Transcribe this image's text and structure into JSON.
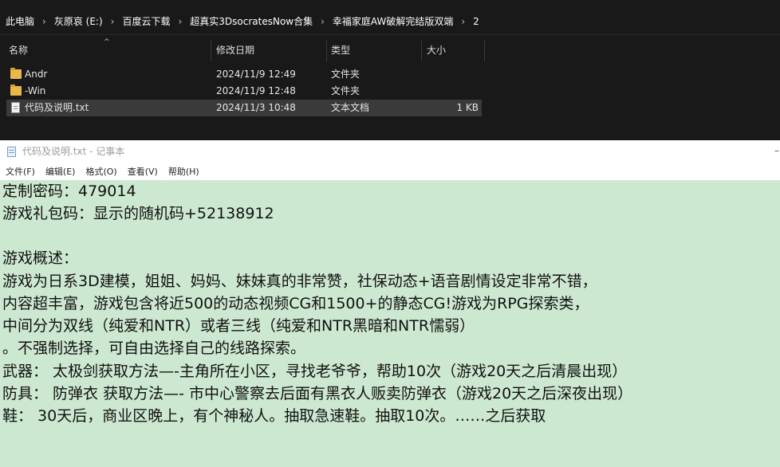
{
  "explorer": {
    "breadcrumb": [
      "此电脑",
      "灰原哀 (E:)",
      "百度云下载",
      "超真实3DsocratesNow合集",
      "幸福家庭AW破解完结版双端",
      "2"
    ],
    "separator": "›",
    "columns": {
      "name": "名称",
      "modified": "修改日期",
      "type": "类型",
      "size": "大小"
    },
    "files": [
      {
        "icon": "folder-icon",
        "name": "Andr",
        "modified": "2024/11/9 12:49",
        "type": "文件夹",
        "size": ""
      },
      {
        "icon": "folder-icon",
        "name": "-Win",
        "modified": "2024/11/9 12:48",
        "type": "文件夹",
        "size": ""
      },
      {
        "icon": "text-file-icon",
        "name": "代码及说明.txt",
        "modified": "2024/11/3 10:48",
        "type": "文本文档",
        "size": "1 KB"
      }
    ]
  },
  "notepad": {
    "title": "代码及说明.txt - 记事本",
    "menu": [
      "文件(F)",
      "编辑(E)",
      "格式(O)",
      "查看(V)",
      "帮助(H)"
    ],
    "editor_background": "#cde8d0",
    "lines": [
      "定制密码：479014",
      "游戏礼包码：显示的随机码+52138912",
      "",
      "游戏概述：",
      "游戏为日系3D建模，姐姐、妈妈、妹妹真的非常赞，社保动态+语音剧情设定非常不错，",
      "内容超丰富，游戏包含将近500的动态视频CG和1500+的静态CG!游戏为RPG探索类，",
      "中间分为双线（纯爱和NTR）或者三线（纯爱和NTR黑暗和NTR懦弱）",
      "。不强制选择，可自由选择自己的线路探索。",
      "武器： 太极剑获取方法—-主角所在小区，寻找老爷爷，帮助10次（游戏20天之后清晨出现）",
      "防具：  防弹衣 获取方法—- 市中心警察去后面有黑衣人贩卖防弹衣（游戏20天之后深夜出现）",
      "鞋：  30天后，商业区晚上，有个神秘人。抽取急速鞋。抽取10次。……之后获取"
    ]
  }
}
